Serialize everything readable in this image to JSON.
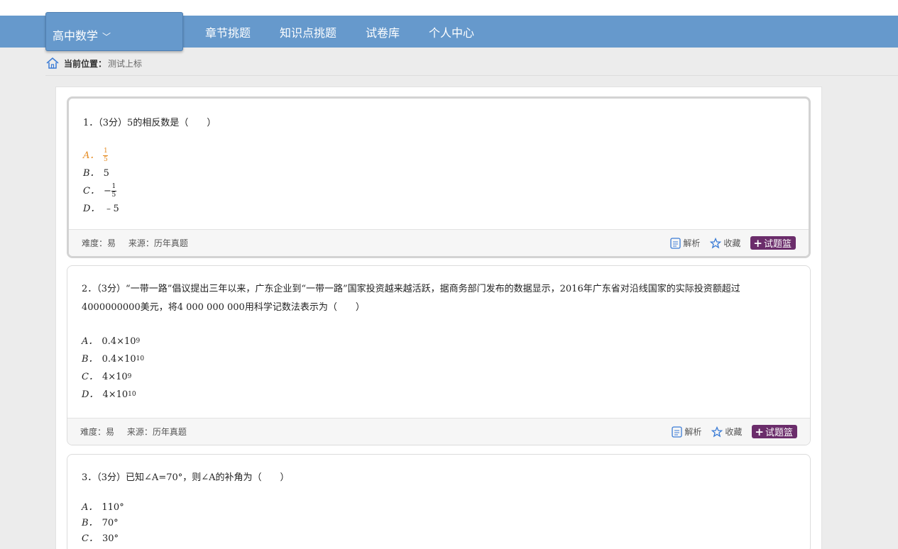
{
  "nav": {
    "subject": "高中数学",
    "links": [
      "章节挑题",
      "知识点挑题",
      "试卷库",
      "个人中心"
    ]
  },
  "breadcrumb": {
    "label": "当前位置：",
    "current": "测试上标"
  },
  "footer_labels": {
    "difficulty": "难度：易",
    "source": "来源：历年真题",
    "analysis": "解析",
    "favorite": "收藏",
    "basket": "试题篮"
  },
  "questions": [
    {
      "stem": "1．（3分）5的相反数是（　　）",
      "options": [
        {
          "letter": "A．",
          "num": "1",
          "den": "5"
        },
        {
          "letter": "B．",
          "text": "5"
        },
        {
          "letter": "C．",
          "prefix": "−",
          "num": "1",
          "den": "5"
        },
        {
          "letter": "D．",
          "text": "﹣5"
        }
      ]
    },
    {
      "stem": "2．（3分）“一带一路”倡议提出三年以来，广东企业到“一带一路”国家投资越来越活跃，据商务部门发布的数据显示，2016年广东省对沿线国家的实际投资额超过4000000000美元，将4 000 000 000用科学记数法表示为（　　）",
      "options": [
        {
          "letter": "A．",
          "base": "0.4×10",
          "exp": "9"
        },
        {
          "letter": "B．",
          "base": "0.4×10",
          "exp": "10"
        },
        {
          "letter": "C．",
          "base": "4×10",
          "exp": "9"
        },
        {
          "letter": "D．",
          "base": "4×10",
          "exp": "10"
        }
      ]
    },
    {
      "stem": "3．（3分）已知∠A=70°，则∠A的补角为（　　）",
      "options": [
        {
          "letter": "A．",
          "text": "110°"
        },
        {
          "letter": "B．",
          "text": "70°"
        },
        {
          "letter": "C．",
          "text": "30°"
        }
      ]
    }
  ],
  "colors": {
    "nav": "#6699cc",
    "selected_option": "#e58a1f",
    "basket": "#6b2d6b",
    "icon": "#3a7bd5"
  }
}
